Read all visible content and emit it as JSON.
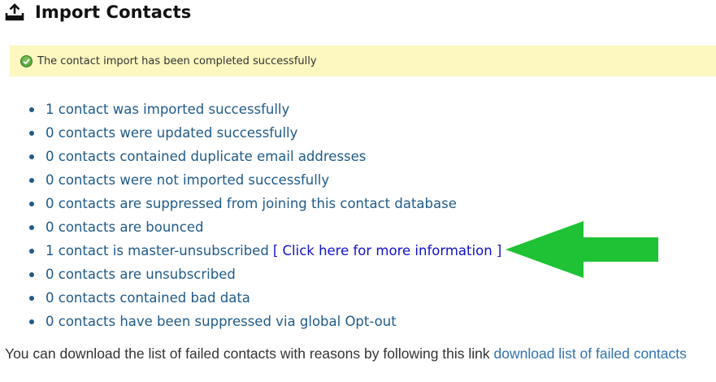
{
  "header": {
    "title": "Import Contacts",
    "icon": "upload-tray-icon"
  },
  "alert": {
    "message": "The contact import has been completed successfully",
    "icon": "check-circle-icon",
    "background": "#fcf8c0"
  },
  "results": [
    {
      "text": "1 contact was imported successfully"
    },
    {
      "text": "0 contacts were updated successfully"
    },
    {
      "text": "0 contacts contained duplicate email addresses"
    },
    {
      "text": "0 contacts were not imported successfully"
    },
    {
      "text": "0 contacts are suppressed from joining this contact database"
    },
    {
      "text": "0 contacts are bounced"
    },
    {
      "text": "1 contact is master-unsubscribed",
      "link": "[ Click here for more information ]"
    },
    {
      "text": "0 contacts are unsubscribed"
    },
    {
      "text": "0 contacts contained bad data"
    },
    {
      "text": "0 contacts have been suppressed via global Opt-out"
    }
  ],
  "annotation": {
    "icon": "green-arrow-icon",
    "color": "#1ec234"
  },
  "footer": {
    "text": "You can download the list of failed contacts with reasons by following this link",
    "link": "download list of failed contacts"
  },
  "colors": {
    "list_text": "#1e5a8a",
    "info_link": "#1111cc",
    "footer_link": "#2f72b2"
  }
}
